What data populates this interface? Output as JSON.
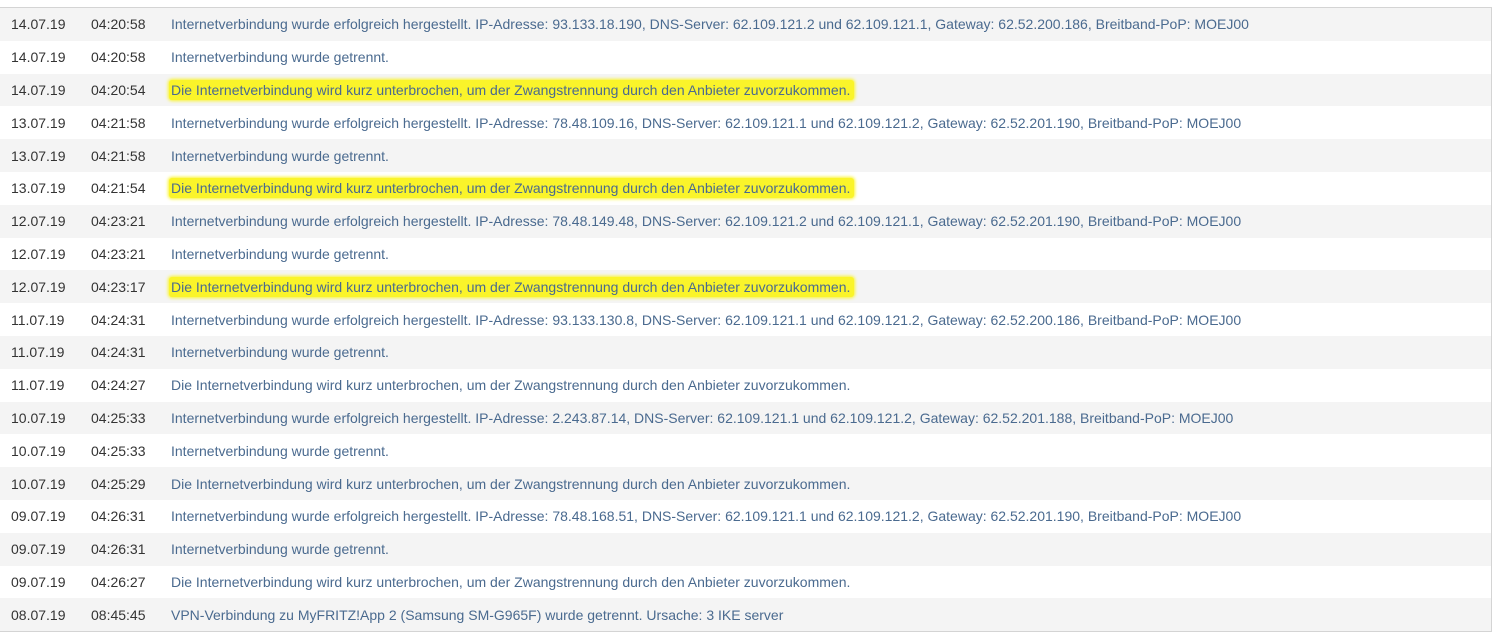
{
  "log": {
    "entries": [
      {
        "date": "14.07.19",
        "time": "04:20:58",
        "message": "Internetverbindung wurde erfolgreich hergestellt. IP-Adresse: 93.133.18.190, DNS-Server: 62.109.121.2 und 62.109.121.1, Gateway: 62.52.200.186, Breitband-PoP: MOEJ00",
        "highlighted": false
      },
      {
        "date": "14.07.19",
        "time": "04:20:58",
        "message": "Internetverbindung wurde getrennt.",
        "highlighted": false
      },
      {
        "date": "14.07.19",
        "time": "04:20:54",
        "message": "Die Internetverbindung wird kurz unterbrochen, um der Zwangstrennung durch den Anbieter zuvorzukommen.",
        "highlighted": true
      },
      {
        "date": "13.07.19",
        "time": "04:21:58",
        "message": "Internetverbindung wurde erfolgreich hergestellt. IP-Adresse: 78.48.109.16, DNS-Server: 62.109.121.1 und 62.109.121.2, Gateway: 62.52.201.190, Breitband-PoP: MOEJ00",
        "highlighted": false
      },
      {
        "date": "13.07.19",
        "time": "04:21:58",
        "message": "Internetverbindung wurde getrennt.",
        "highlighted": false
      },
      {
        "date": "13.07.19",
        "time": "04:21:54",
        "message": "Die Internetverbindung wird kurz unterbrochen, um der Zwangstrennung durch den Anbieter zuvorzukommen.",
        "highlighted": true
      },
      {
        "date": "12.07.19",
        "time": "04:23:21",
        "message": "Internetverbindung wurde erfolgreich hergestellt. IP-Adresse: 78.48.149.48, DNS-Server: 62.109.121.2 und 62.109.121.1, Gateway: 62.52.201.190, Breitband-PoP: MOEJ00",
        "highlighted": false
      },
      {
        "date": "12.07.19",
        "time": "04:23:21",
        "message": "Internetverbindung wurde getrennt.",
        "highlighted": false
      },
      {
        "date": "12.07.19",
        "time": "04:23:17",
        "message": "Die Internetverbindung wird kurz unterbrochen, um der Zwangstrennung durch den Anbieter zuvorzukommen.",
        "highlighted": true
      },
      {
        "date": "11.07.19",
        "time": "04:24:31",
        "message": "Internetverbindung wurde erfolgreich hergestellt. IP-Adresse: 93.133.130.8, DNS-Server: 62.109.121.1 und 62.109.121.2, Gateway: 62.52.200.186, Breitband-PoP: MOEJ00",
        "highlighted": false
      },
      {
        "date": "11.07.19",
        "time": "04:24:31",
        "message": "Internetverbindung wurde getrennt.",
        "highlighted": false
      },
      {
        "date": "11.07.19",
        "time": "04:24:27",
        "message": "Die Internetverbindung wird kurz unterbrochen, um der Zwangstrennung durch den Anbieter zuvorzukommen.",
        "highlighted": false
      },
      {
        "date": "10.07.19",
        "time": "04:25:33",
        "message": "Internetverbindung wurde erfolgreich hergestellt. IP-Adresse: 2.243.87.14, DNS-Server: 62.109.121.1 und 62.109.121.2, Gateway: 62.52.201.188, Breitband-PoP: MOEJ00",
        "highlighted": false
      },
      {
        "date": "10.07.19",
        "time": "04:25:33",
        "message": "Internetverbindung wurde getrennt.",
        "highlighted": false
      },
      {
        "date": "10.07.19",
        "time": "04:25:29",
        "message": "Die Internetverbindung wird kurz unterbrochen, um der Zwangstrennung durch den Anbieter zuvorzukommen.",
        "highlighted": false
      },
      {
        "date": "09.07.19",
        "time": "04:26:31",
        "message": "Internetverbindung wurde erfolgreich hergestellt. IP-Adresse: 78.48.168.51, DNS-Server: 62.109.121.1 und 62.109.121.2, Gateway: 62.52.201.190, Breitband-PoP: MOEJ00",
        "highlighted": false
      },
      {
        "date": "09.07.19",
        "time": "04:26:31",
        "message": "Internetverbindung wurde getrennt.",
        "highlighted": false
      },
      {
        "date": "09.07.19",
        "time": "04:26:27",
        "message": "Die Internetverbindung wird kurz unterbrochen, um der Zwangstrennung durch den Anbieter zuvorzukommen.",
        "highlighted": false
      },
      {
        "date": "08.07.19",
        "time": "08:45:45",
        "message": "VPN-Verbindung zu MyFRITZ!App 2 (Samsung SM-G965F) wurde getrennt. Ursache: 3 IKE server",
        "highlighted": false
      }
    ]
  },
  "colors": {
    "highlight": "#faf42a",
    "message_text": "#4a6a8f",
    "date_text": "#333333",
    "row_stripe": "#f4f4f4"
  }
}
